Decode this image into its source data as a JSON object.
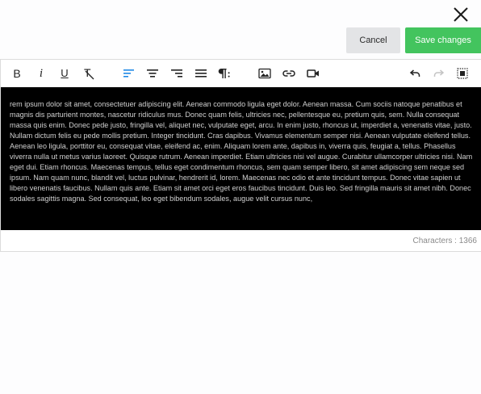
{
  "dialog": {
    "cancel_label": "Cancel",
    "save_label": "Save changes"
  },
  "toolbar": {
    "bold_label": "B",
    "italic_label": "i",
    "underline_label": "U",
    "clear_format_label": "T",
    "icons": [
      "bold-icon",
      "italic-icon",
      "underline-icon",
      "clear-format-icon",
      "align-left-icon",
      "align-center-icon",
      "align-right-icon",
      "align-justify-icon",
      "paragraph-format-icon",
      "insert-image-icon",
      "insert-link-icon",
      "insert-video-icon",
      "undo-icon",
      "redo-icon",
      "select-all-icon"
    ]
  },
  "editor": {
    "content": "rem ipsum dolor sit amet, consectetuer adipiscing elit. Aenean commodo ligula eget dolor. Aenean massa. Cum sociis natoque penatibus et magnis dis parturient montes, nascetur ridiculus mus. Donec quam felis, ultricies nec, pellentesque eu, pretium quis, sem. Nulla consequat massa quis enim. Donec pede justo, fringilla vel, aliquet nec, vulputate eget, arcu. In enim justo, rhoncus ut, imperdiet a, venenatis vitae, justo. Nullam dictum felis eu pede mollis pretium. Integer tincidunt. Cras dapibus. Vivamus elementum semper nisi. Aenean vulputate eleifend tellus. Aenean leo ligula, porttitor eu, consequat vitae, eleifend ac, enim. Aliquam lorem ante, dapibus in, viverra quis, feugiat a, tellus. Phasellus viverra nulla ut metus varius laoreet. Quisque rutrum. Aenean imperdiet. Etiam ultricies nisi vel augue. Curabitur ullamcorper ultricies nisi. Nam eget dui. Etiam rhoncus. Maecenas tempus, tellus eget condimentum rhoncus, sem quam semper libero, sit amet adipiscing sem neque sed ipsum. Nam quam nunc, blandit vel, luctus pulvinar, hendrerit id, lorem. Maecenas nec odio et ante tincidunt tempus. Donec vitae sapien ut libero venenatis faucibus. Nullam quis ante. Etiam sit amet orci eget eros faucibus tincidunt. Duis leo. Sed fringilla mauris sit amet nibh. Donec sodales sagittis magna. Sed consequat, leo eget bibendum sodales, augue velit cursus nunc,",
    "char_count": "Characters : 1366"
  },
  "colors": {
    "save_button": "#43c45e",
    "cancel_button": "#e3e4e6",
    "active_align": "#1e88e5",
    "content_background": "#000000",
    "content_text": "#d0d0d0"
  }
}
